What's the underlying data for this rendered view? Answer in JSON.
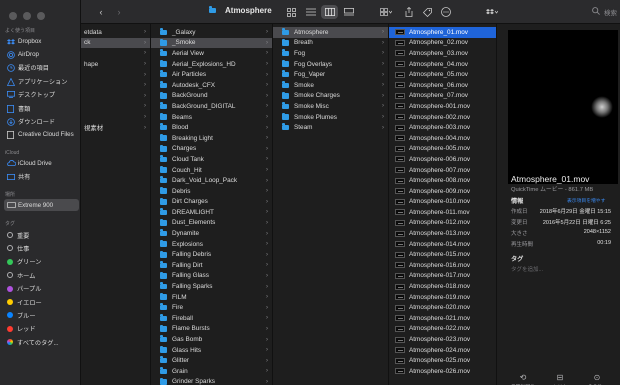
{
  "toolbar": {
    "title": "Atmosphere",
    "search_placeholder": "検索",
    "icons": [
      "back-icon",
      "forward-icon",
      "icon-view-icon",
      "list-view-icon",
      "column-view-icon",
      "gallery-view-icon",
      "group-icon",
      "share-icon",
      "tag-icon",
      "more-icon",
      "dropbox-icon",
      "search-icon"
    ]
  },
  "sidebar": {
    "favorites_header": "よく使う項目",
    "favorites": [
      {
        "label": "Dropbox",
        "icon": "dropbox-icon"
      },
      {
        "label": "AirDrop",
        "icon": "airdrop-icon"
      },
      {
        "label": "最近の項目",
        "icon": "clock-icon"
      },
      {
        "label": "アプリケーション",
        "icon": "applications-icon"
      },
      {
        "label": "デスクトップ",
        "icon": "desktop-icon"
      },
      {
        "label": "書類",
        "icon": "document-icon"
      },
      {
        "label": "ダウンロード",
        "icon": "download-icon"
      },
      {
        "label": "Creative Cloud Files",
        "icon": "creative-cloud-icon"
      }
    ],
    "icloud_header": "iCloud",
    "icloud": [
      {
        "label": "iCloud Drive",
        "icon": "cloud-icon"
      },
      {
        "label": "共有",
        "icon": "shared-folder-icon"
      }
    ],
    "locations_header": "場所",
    "locations": [
      {
        "label": "Extreme 900",
        "icon": "drive-icon"
      }
    ],
    "tags_header": "タグ",
    "tags": [
      {
        "label": "重要",
        "color": "#2a2a2c",
        "hollow": true
      },
      {
        "label": "仕事",
        "color": "#2a2a2c",
        "hollow": true
      },
      {
        "label": "グリーン",
        "color": "#34c759"
      },
      {
        "label": "ホーム",
        "color": "#2a2a2c",
        "hollow": true
      },
      {
        "label": "パープル",
        "color": "#af52de"
      },
      {
        "label": "イエロー",
        "color": "#ffcc00"
      },
      {
        "label": "ブルー",
        "color": "#0a84ff"
      },
      {
        "label": "レッド",
        "color": "#ff3b30"
      },
      {
        "label": "すべてのタグ...",
        "color": "#8e8e93",
        "multi": true
      }
    ]
  },
  "column1": {
    "items": [
      {
        "label": "etdata",
        "chevron": true
      },
      {
        "label": "ck",
        "chevron": true,
        "selected": true
      },
      {
        "label": "",
        "chevron": true
      },
      {
        "label": "hape",
        "chevron": true
      },
      {
        "label": "",
        "chevron": true
      },
      {
        "label": "",
        "chevron": true
      },
      {
        "label": "",
        "chevron": true
      },
      {
        "label": "",
        "chevron": true
      },
      {
        "label": "",
        "chevron": true
      },
      {
        "label": "視素材",
        "chevron": true
      }
    ]
  },
  "column2": {
    "items": [
      "_Galaxy",
      "_Smoke",
      "Aerial View",
      "Aerial_Explosions_HD",
      "Air Particles",
      "Autodesk_CFX",
      "BackGround",
      "BackGround_DIGITAL",
      "Beams",
      "Blood",
      "Breaking Light",
      "Charges",
      "Cloud Tank",
      "Couch_Hit",
      "Dark_Void_Loop_Pack",
      "Debris",
      "Dirt Charges",
      "DREAMLIGHT",
      "Dust_Elements",
      "Dynamite",
      "Explosions",
      "Falling Debris",
      "Falling Dirt",
      "Falling Glass",
      "Falling Sparks",
      "FILM",
      "Fire",
      "Fireball",
      "Flame Bursts",
      "Gas Bomb",
      "Glass Hits",
      "Glitter",
      "Grain",
      "Grinder Sparks"
    ],
    "selected": "_Smoke"
  },
  "column3": {
    "items": [
      "Atmosphere",
      "Breath",
      "Fog",
      "Fog Overlays",
      "Fog_Vaper",
      "Smoke",
      "Smoke Charges",
      "Smoke Misc",
      "Smoke Plumes",
      "Steam"
    ],
    "selected": "Atmosphere"
  },
  "column4": {
    "items": [
      "Atmosphere_01.mov",
      "Atmosphere_02.mov",
      "Atmosphere_03.mov",
      "Atmosphere_04.mov",
      "Atmosphere_05.mov",
      "Atmosphere_06.mov",
      "Atmosphere_07.mov",
      "Atmosphere-001.mov",
      "Atmosphere-002.mov",
      "Atmosphere-003.mov",
      "Atmosphere-004.mov",
      "Atmosphere-005.mov",
      "Atmosphere-006.mov",
      "Atmosphere-007.mov",
      "Atmosphere-008.mov",
      "Atmosphere-009.mov",
      "Atmosphere-010.mov",
      "Atmosphere-011.mov",
      "Atmosphere-012.mov",
      "Atmosphere-013.mov",
      "Atmosphere-014.mov",
      "Atmosphere-015.mov",
      "Atmosphere-016.mov",
      "Atmosphere-017.mov",
      "Atmosphere-018.mov",
      "Atmosphere-019.mov",
      "Atmosphere-020.mov",
      "Atmosphere-021.mov",
      "Atmosphere-022.mov",
      "Atmosphere-023.mov",
      "Atmosphere-024.mov",
      "Atmosphere-025.mov",
      "Atmosphere-026.mov"
    ],
    "selected": "Atmosphere_01.mov"
  },
  "preview": {
    "filename": "Atmosphere_01.mov",
    "kind": "QuickTime ムービー - 861.7 MB",
    "info_header": "情報",
    "show_more": "表示項目を増やす",
    "info": [
      {
        "key": "作成日",
        "value": "2018年6月29日 金曜日 15:15"
      },
      {
        "key": "変更日",
        "value": "2016年5月22日 日曜日 6:25"
      },
      {
        "key": "大きさ",
        "value": "2048×1152"
      },
      {
        "key": "再生時間",
        "value": "00:19"
      }
    ],
    "tags_header": "タグ",
    "tags_placeholder": "タグを追加...",
    "actions": [
      {
        "label": "反時計回りに回転",
        "icon": "rotate-left-icon"
      },
      {
        "label": "トリム",
        "icon": "trim-icon"
      },
      {
        "label": "その他...",
        "icon": "more-actions-icon"
      }
    ]
  }
}
